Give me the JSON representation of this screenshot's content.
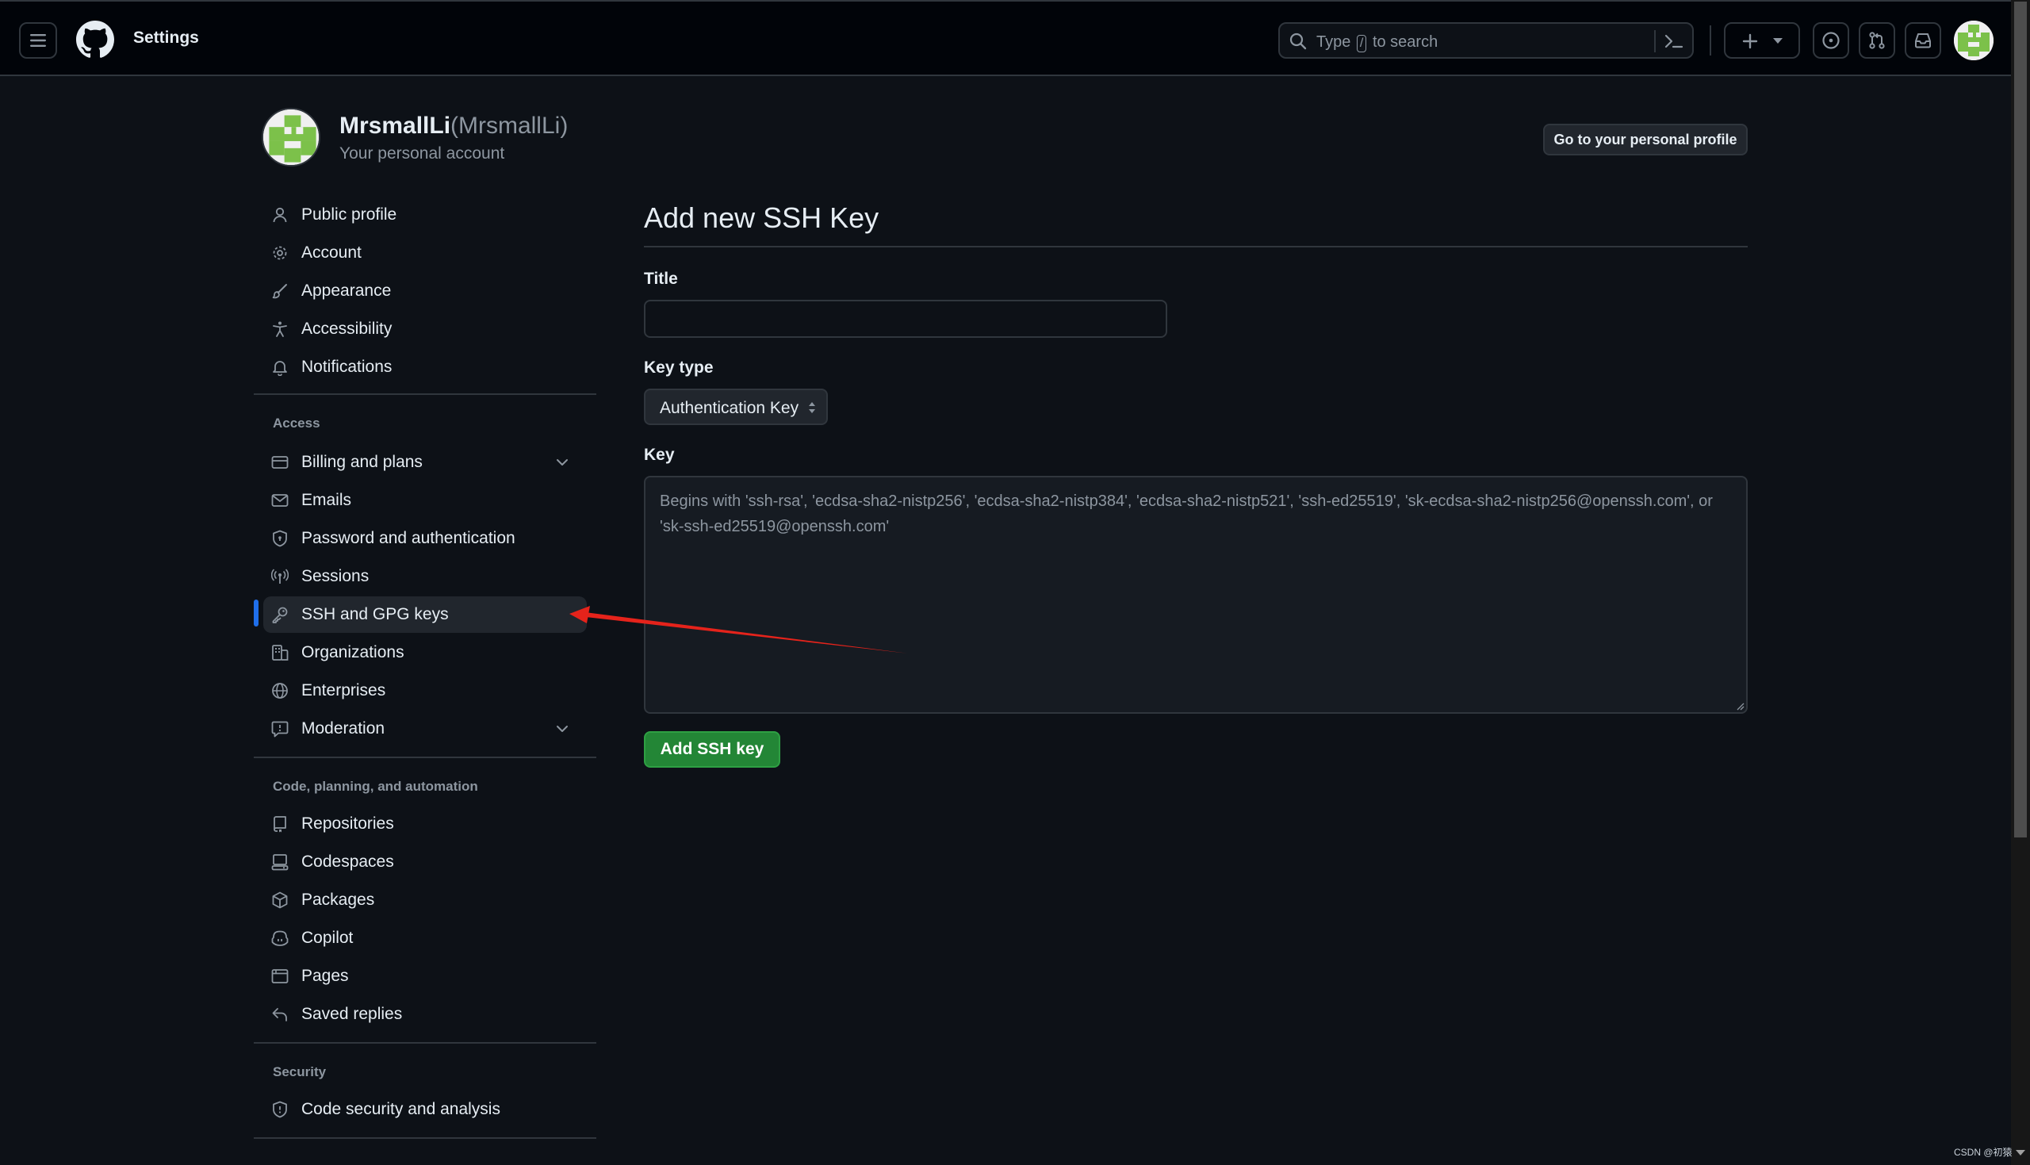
{
  "header": {
    "title": "Settings",
    "search_pre": "Type",
    "search_key": "/",
    "search_post": "to search"
  },
  "account": {
    "name": "MrsmallLi",
    "login": "(MrsmallLi)",
    "subtitle": "Your personal account",
    "profile_button": "Go to your personal profile"
  },
  "sidebar": {
    "items_top": [
      {
        "label": "Public profile",
        "icon": "person-icon"
      },
      {
        "label": "Account",
        "icon": "gear-icon"
      },
      {
        "label": "Appearance",
        "icon": "paintbrush-icon"
      },
      {
        "label": "Accessibility",
        "icon": "accessibility-icon"
      },
      {
        "label": "Notifications",
        "icon": "bell-icon"
      }
    ],
    "access_heading": "Access",
    "items_access": [
      {
        "label": "Billing and plans",
        "icon": "credit-card-icon"
      },
      {
        "label": "Emails",
        "icon": "mail-icon"
      },
      {
        "label": "Password and authentication",
        "icon": "shield-lock-icon"
      },
      {
        "label": "Sessions",
        "icon": "broadcast-icon"
      },
      {
        "label": "SSH and GPG keys",
        "icon": "key-icon"
      },
      {
        "label": "Organizations",
        "icon": "organization-icon"
      },
      {
        "label": "Enterprises",
        "icon": "globe-icon"
      },
      {
        "label": "Moderation",
        "icon": "report-icon"
      }
    ],
    "code_heading": "Code, planning, and automation",
    "items_code": [
      {
        "label": "Repositories",
        "icon": "repo-icon"
      },
      {
        "label": "Codespaces",
        "icon": "codespaces-icon"
      },
      {
        "label": "Packages",
        "icon": "package-icon"
      },
      {
        "label": "Copilot",
        "icon": "copilot-icon"
      },
      {
        "label": "Pages",
        "icon": "browser-icon"
      },
      {
        "label": "Saved replies",
        "icon": "reply-icon"
      }
    ],
    "security_heading": "Security",
    "items_security": [
      {
        "label": "Code security and analysis",
        "icon": "shield-icon"
      }
    ]
  },
  "main": {
    "title": "Add new SSH Key",
    "title_label": "Title",
    "title_value": "",
    "keytype_label": "Key type",
    "keytype_value": "Authentication Key",
    "key_label": "Key",
    "key_placeholder": "Begins with 'ssh-rsa', 'ecdsa-sha2-nistp256', 'ecdsa-sha2-nistp384', 'ecdsa-sha2-nistp521', 'ssh-ed25519', 'sk-ecdsa-sha2-nistp256@openssh.com', or 'sk-ssh-ed25519@openssh.com'",
    "submit_label": "Add SSH key"
  },
  "watermark": "CSDN @初猿",
  "colors": {
    "background": "#0d1117",
    "header": "#010409",
    "accent_blue": "#1f6feb",
    "button_green": "#238636",
    "annotation_red": "#e5231b"
  }
}
